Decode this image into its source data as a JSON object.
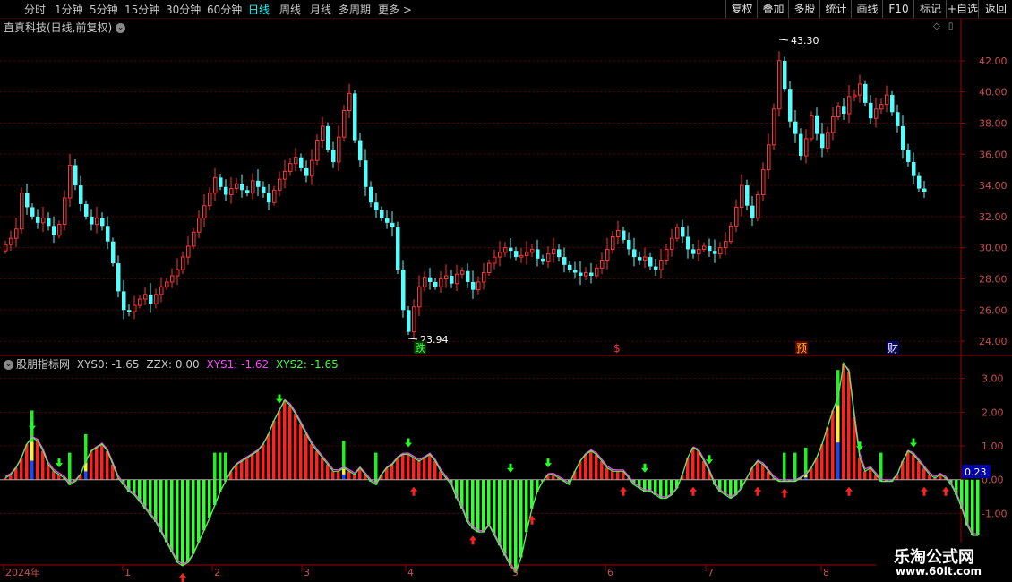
{
  "toolbar": {
    "periods": [
      "分时",
      "1分钟",
      "5分钟",
      "15分钟",
      "30分钟",
      "60分钟",
      "日线",
      "周线",
      "月线",
      "多周期",
      "更多 >"
    ],
    "active_period": "日线",
    "buttons": [
      "复权",
      "叠加",
      "多股",
      "统计",
      "画线",
      "F10",
      "标记",
      "+自选",
      "返回"
    ]
  },
  "stock": {
    "title": "直真科技(日线,前复权)",
    "high_label": "43.30",
    "low_label": "23.94"
  },
  "indicator": {
    "name": "股朋指标网",
    "items": [
      {
        "label": "XYS0: -1.65",
        "color": "#c8c8c8"
      },
      {
        "label": "ZZX: 0.00",
        "color": "#c8c8c8"
      },
      {
        "label": "XYS1: -1.62",
        "color": "#ff44ff"
      },
      {
        "label": "XYS2: -1.65",
        "color": "#44ff44"
      }
    ],
    "current_value": "0.23"
  },
  "event_markers": [
    {
      "text": "跌",
      "color": "#44ff44",
      "bg": "#003300"
    },
    {
      "text": "$",
      "color": "#ff3333",
      "bg": "#000"
    },
    {
      "text": "预",
      "color": "#ffcc00",
      "bg": "#660000"
    },
    {
      "text": "财",
      "color": "#ffffff",
      "bg": "#000066"
    }
  ],
  "time_axis": [
    "2024年",
    "1",
    "2",
    "3",
    "4",
    "5",
    "6",
    "7",
    "8"
  ],
  "watermark": {
    "line1": "乐淘公式网",
    "line2": "www.60lt.com"
  },
  "colors": {
    "up": "#ff3333",
    "down": "#54ffff",
    "grid": "#5a0000",
    "axis": "#a00000",
    "text": "#c8c8c8"
  },
  "chart_data": [
    {
      "type": "candlestick",
      "title": "直真科技(日线,前复权)",
      "y_ticks": [
        "42.00",
        "40.00",
        "38.00",
        "36.00",
        "34.00",
        "32.00",
        "30.00",
        "28.00",
        "26.00",
        "24.00"
      ],
      "ylim": [
        23.2,
        43.6
      ],
      "annotations": [
        {
          "label": "43.30",
          "type": "high"
        },
        {
          "label": "23.94",
          "type": "low"
        }
      ],
      "close_series": [
        30.2,
        30.6,
        31.2,
        33.5,
        32.6,
        32.0,
        31.6,
        31.9,
        31.4,
        30.8,
        31.5,
        33.2,
        35.3,
        34.0,
        32.8,
        32.0,
        31.5,
        31.9,
        31.4,
        30.4,
        29.0,
        27.2,
        26.0,
        25.9,
        26.3,
        26.7,
        27.0,
        26.4,
        27.0,
        27.5,
        27.8,
        28.2,
        28.6,
        29.4,
        30.1,
        31.0,
        31.9,
        32.7,
        33.5,
        34.5,
        33.9,
        33.4,
        33.8,
        34.1,
        33.7,
        33.5,
        34.3,
        33.9,
        33.5,
        32.9,
        33.7,
        34.4,
        34.9,
        35.4,
        35.8,
        35.1,
        34.6,
        35.6,
        36.9,
        37.8,
        36.3,
        35.5,
        37.1,
        38.8,
        39.9,
        36.9,
        35.6,
        33.9,
        32.9,
        32.4,
        31.9,
        31.6,
        31.3,
        28.6,
        26.0,
        24.6,
        26.2,
        27.5,
        28.1,
        27.8,
        27.5,
        28.0,
        28.2,
        27.7,
        28.3,
        28.5,
        27.8,
        27.3,
        27.8,
        28.4,
        29.0,
        29.4,
        29.7,
        30.0,
        29.8,
        29.4,
        29.5,
        29.7,
        29.9,
        29.3,
        29.1,
        29.6,
        29.9,
        29.4,
        28.9,
        28.6,
        28.4,
        28.2,
        28.4,
        28.2,
        28.7,
        29.2,
        29.9,
        30.7,
        31.1,
        30.5,
        29.9,
        29.4,
        29.2,
        29.4,
        28.8,
        28.6,
        29.2,
        29.9,
        30.6,
        31.3,
        30.7,
        29.9,
        29.6,
        29.9,
        30.1,
        29.8,
        29.6,
        30.0,
        30.4,
        31.4,
        32.6,
        34.0,
        32.7,
        31.9,
        33.4,
        35.0,
        36.6,
        38.9,
        42.0,
        40.2,
        38.1,
        37.3,
        35.9,
        37.0,
        38.5,
        37.3,
        36.4,
        37.4,
        38.4,
        39.1,
        38.6,
        39.7,
        39.8,
        40.5,
        39.3,
        38.3,
        38.9,
        39.2,
        39.8,
        38.7,
        37.8,
        36.3,
        35.5,
        34.6,
        33.8,
        33.6
      ]
    },
    {
      "type": "histogram_with_lines",
      "title": "股朋指标网",
      "y_ticks": [
        "3.00",
        "2.00",
        "1.00",
        "0.00",
        "-1.00"
      ],
      "ylim": [
        -2.5,
        3.6
      ],
      "series": [
        {
          "name": "XYS0",
          "value": -1.65
        },
        {
          "name": "ZZX",
          "value": 0.0
        },
        {
          "name": "XYS1",
          "value": -1.62
        },
        {
          "name": "XYS2",
          "value": -1.65
        }
      ],
      "values": [
        0.05,
        0.15,
        0.35,
        0.65,
        1.05,
        1.25,
        1.15,
        0.85,
        0.45,
        0.25,
        0.15,
        0.05,
        -0.15,
        -0.05,
        0.15,
        0.55,
        0.85,
        0.95,
        1.05,
        0.85,
        0.45,
        0.05,
        -0.15,
        -0.35,
        -0.45,
        -0.65,
        -0.85,
        -1.05,
        -1.25,
        -1.55,
        -1.85,
        -2.15,
        -2.45,
        -2.55,
        -2.45,
        -2.2,
        -1.85,
        -1.5,
        -1.15,
        -0.75,
        -0.35,
        -0.05,
        0.25,
        0.45,
        0.55,
        0.65,
        0.75,
        0.85,
        1.05,
        1.35,
        1.75,
        2.05,
        2.35,
        2.2,
        1.95,
        1.65,
        1.35,
        1.05,
        0.85,
        0.65,
        0.45,
        0.25,
        0.25,
        0.35,
        0.25,
        0.15,
        0.35,
        0.15,
        -0.05,
        -0.15,
        0.15,
        0.35,
        0.45,
        0.65,
        0.75,
        0.75,
        0.65,
        0.55,
        0.65,
        0.75,
        0.55,
        0.25,
        0.05,
        -0.15,
        -0.55,
        -0.85,
        -1.25,
        -1.45,
        -1.55,
        -1.55,
        -1.35,
        -1.65,
        -1.95,
        -2.25,
        -2.55,
        -2.75,
        -2.3,
        -1.55,
        -0.85,
        -0.35,
        -0.05,
        0.15,
        0.15,
        0.05,
        -0.05,
        -0.15,
        0.25,
        0.55,
        0.75,
        0.85,
        0.75,
        0.55,
        0.35,
        0.25,
        0.25,
        0.25,
        0.05,
        -0.15,
        -0.25,
        -0.35,
        -0.35,
        -0.45,
        -0.55,
        -0.55,
        -0.45,
        -0.25,
        0.15,
        0.65,
        0.95,
        0.85,
        0.55,
        0.25,
        -0.15,
        -0.35,
        -0.45,
        -0.55,
        -0.45,
        -0.25,
        0.05,
        0.35,
        0.55,
        0.45,
        0.25,
        0.05,
        -0.05,
        -0.05,
        -0.05,
        -0.05,
        0.05,
        0.15,
        0.35,
        0.65,
        1.05,
        1.55,
        2.05,
        2.45,
        3.45,
        3.2,
        1.85,
        0.65,
        0.25,
        0.35,
        0.15,
        -0.05,
        -0.05,
        -0.05,
        0.15,
        0.55,
        0.85,
        0.75,
        0.55,
        0.35,
        0.15,
        0.05,
        0.15,
        0.05,
        -0.15,
        -0.45,
        -0.85,
        -1.35,
        -1.65,
        -1.65
      ],
      "buy_arrows": [
        33,
        76,
        87,
        98,
        115,
        128,
        140,
        145,
        157,
        171,
        175,
        180,
        187,
        194
      ],
      "sell_arrows": [
        5,
        10,
        51,
        75,
        94,
        101,
        119,
        131,
        159,
        169,
        182,
        198
      ],
      "current_value": 0.23
    }
  ]
}
